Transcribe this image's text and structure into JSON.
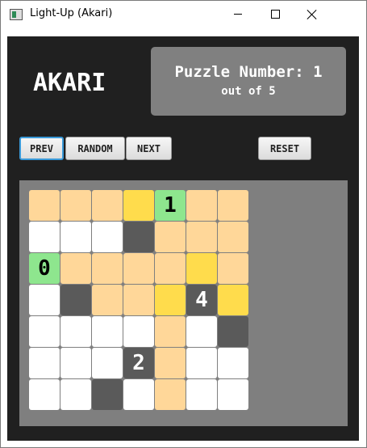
{
  "window": {
    "title": "Light-Up (Akari)",
    "accent": "#3a9ad9"
  },
  "header": {
    "logo": "AKARI",
    "puzzle_line": "Puzzle Number: 1",
    "count_line": "out of 5"
  },
  "toolbar": {
    "prev": "PREV",
    "random": "RANDOM",
    "next": "NEXT",
    "reset": "RESET"
  },
  "board": {
    "colors": {
      "empty": "#ffffff",
      "lit": "#ffd799",
      "bulb": "#ffdc4c",
      "wall": "#5a5a5a",
      "satisfied_wall": "#8ee68e"
    },
    "rows": [
      [
        {
          "t": "lit"
        },
        {
          "t": "lit"
        },
        {
          "t": "lit"
        },
        {
          "t": "bulb"
        },
        {
          "t": "wall-ok",
          "n": "1"
        },
        {
          "t": "lit"
        },
        {
          "t": "lit"
        }
      ],
      [
        {
          "t": "empty"
        },
        {
          "t": "empty"
        },
        {
          "t": "empty"
        },
        {
          "t": "wall"
        },
        {
          "t": "lit"
        },
        {
          "t": "lit"
        },
        {
          "t": "lit"
        }
      ],
      [
        {
          "t": "wall-ok",
          "n": "0"
        },
        {
          "t": "lit"
        },
        {
          "t": "lit"
        },
        {
          "t": "lit"
        },
        {
          "t": "lit"
        },
        {
          "t": "bulb"
        },
        {
          "t": "lit"
        }
      ],
      [
        {
          "t": "empty"
        },
        {
          "t": "wall"
        },
        {
          "t": "lit"
        },
        {
          "t": "lit"
        },
        {
          "t": "bulb"
        },
        {
          "t": "wall",
          "n": "4"
        },
        {
          "t": "bulb"
        }
      ],
      [
        {
          "t": "empty"
        },
        {
          "t": "empty"
        },
        {
          "t": "empty"
        },
        {
          "t": "empty"
        },
        {
          "t": "lit"
        },
        {
          "t": "empty"
        },
        {
          "t": "wall"
        }
      ],
      [
        {
          "t": "empty"
        },
        {
          "t": "empty"
        },
        {
          "t": "empty"
        },
        {
          "t": "wall",
          "n": "2"
        },
        {
          "t": "lit"
        },
        {
          "t": "empty"
        },
        {
          "t": "empty"
        }
      ],
      [
        {
          "t": "empty"
        },
        {
          "t": "empty"
        },
        {
          "t": "wall"
        },
        {
          "t": "empty"
        },
        {
          "t": "lit"
        },
        {
          "t": "empty"
        },
        {
          "t": "empty"
        }
      ]
    ]
  }
}
